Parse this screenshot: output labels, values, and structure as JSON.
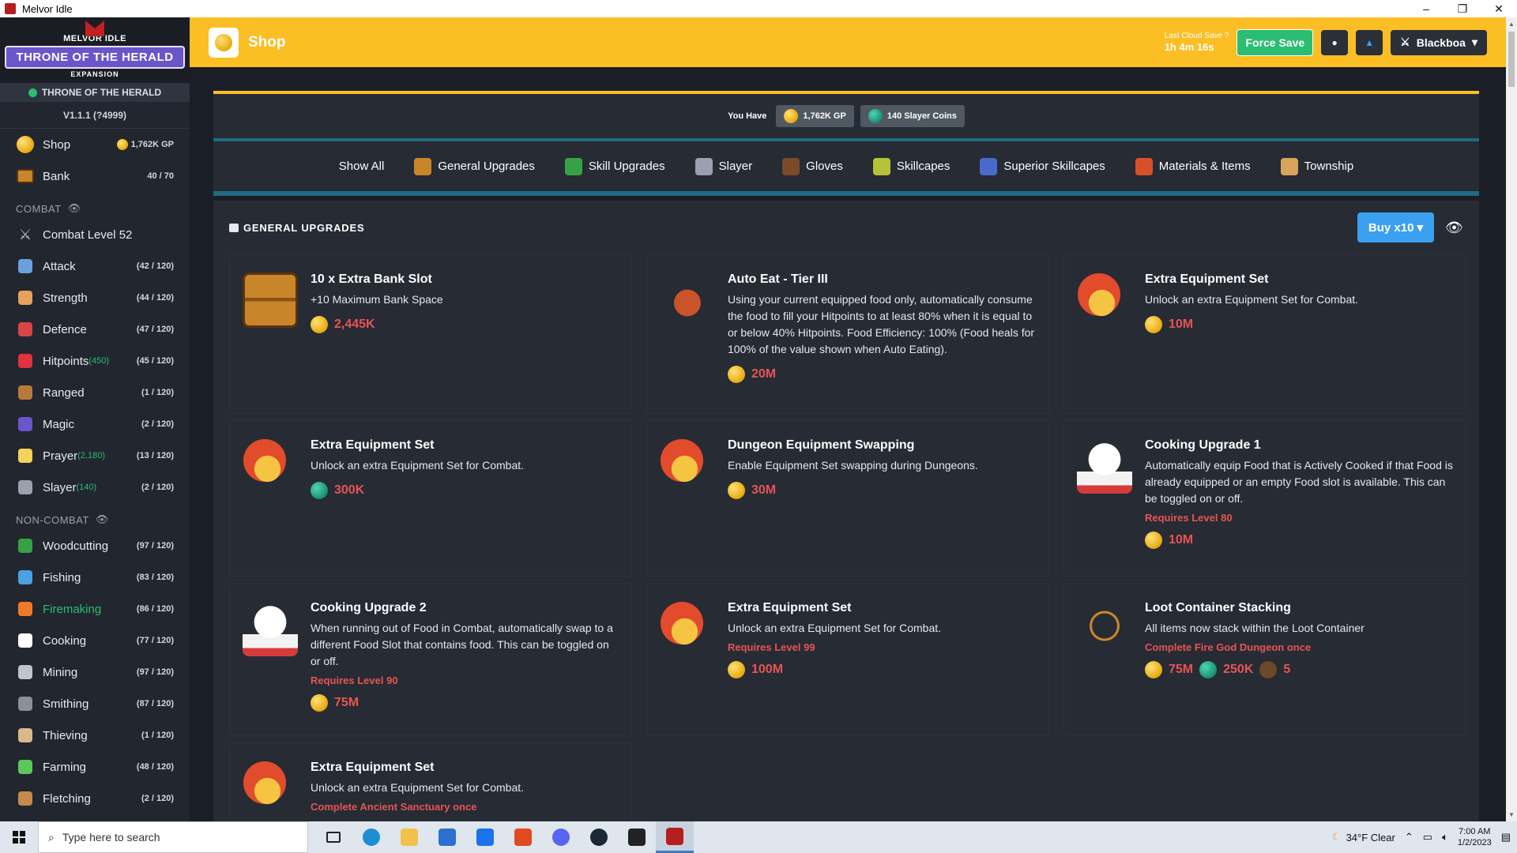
{
  "window": {
    "title": "Melvor Idle",
    "controls": [
      "–",
      "❐",
      "✕"
    ]
  },
  "logo": {
    "top": "MELVOR IDLE",
    "main": "THRONE OF THE HERALD",
    "sub": "EXPANSION"
  },
  "sidebar": {
    "expansion": "THRONE OF THE HERALD",
    "version": "V1.1.1 (?4999)",
    "top_items": [
      {
        "label": "Shop",
        "right": "1,762K GP",
        "icon": "shop-icon"
      },
      {
        "label": "Bank",
        "right": "40 / 70",
        "icon": "bank-icon"
      }
    ],
    "combat_label": "COMBAT",
    "combat_level": "Combat Level 52",
    "combat_items": [
      {
        "label": "Attack",
        "extra": "",
        "right": "(42 / 120)",
        "icon": "sword-icon",
        "color": "#6aa0e0"
      },
      {
        "label": "Strength",
        "extra": "",
        "right": "(44 / 120)",
        "icon": "fist-icon",
        "color": "#e6a15a"
      },
      {
        "label": "Defence",
        "extra": "",
        "right": "(47 / 120)",
        "icon": "shield-icon",
        "color": "#d84545"
      },
      {
        "label": "Hitpoints",
        "extra": "(450)",
        "right": "(45 / 120)",
        "icon": "heart-icon",
        "color": "#e0323f"
      },
      {
        "label": "Ranged",
        "extra": "",
        "right": "(1 / 120)",
        "icon": "bow-icon",
        "color": "#b87a3a"
      },
      {
        "label": "Magic",
        "extra": "",
        "right": "(2 / 120)",
        "icon": "wizard-hat-icon",
        "color": "#6a55c9"
      },
      {
        "label": "Prayer",
        "extra": "(2,180)",
        "right": "(13 / 120)",
        "icon": "prayer-icon",
        "color": "#f5d35a"
      },
      {
        "label": "Slayer",
        "extra": "(140)",
        "right": "(2 / 120)",
        "icon": "slayer-icon",
        "color": "#9aa1ad"
      }
    ],
    "noncombat_label": "NON-COMBAT",
    "noncombat_items": [
      {
        "label": "Woodcutting",
        "right": "(97 / 120)",
        "icon": "tree-icon",
        "color": "#37a245",
        "active": false
      },
      {
        "label": "Fishing",
        "right": "(83 / 120)",
        "icon": "fish-icon",
        "color": "#4aa3e0",
        "active": false
      },
      {
        "label": "Firemaking",
        "right": "(86 / 120)",
        "icon": "fire-icon",
        "color": "#f07a2a",
        "active": true
      },
      {
        "label": "Cooking",
        "right": "(77 / 120)",
        "icon": "chef-hat-icon",
        "color": "#ffffff",
        "active": false
      },
      {
        "label": "Mining",
        "right": "(97 / 120)",
        "icon": "pickaxe-icon",
        "color": "#c0c4cc",
        "active": false
      },
      {
        "label": "Smithing",
        "right": "(87 / 120)",
        "icon": "anvil-icon",
        "color": "#8a8f98",
        "active": false
      },
      {
        "label": "Thieving",
        "right": "(1 / 120)",
        "icon": "thief-icon",
        "color": "#d7b98a",
        "active": false
      },
      {
        "label": "Farming",
        "right": "(48 / 120)",
        "icon": "sprout-icon",
        "color": "#5ac85a",
        "active": false
      },
      {
        "label": "Fletching",
        "right": "(2 / 120)",
        "icon": "arrow-icon",
        "color": "#c68a4a",
        "active": false
      }
    ]
  },
  "header": {
    "title": "Shop",
    "cloud_label": "Last Cloud Save",
    "cloud_time": "1h 4m 16s",
    "force_save": "Force Save",
    "character": "Blackboa"
  },
  "wallet": {
    "label": "You Have",
    "gp": "1,762K GP",
    "slayer": "140 Slayer Coins"
  },
  "tabs": [
    {
      "label": "Show All",
      "color": ""
    },
    {
      "label": "General Upgrades",
      "color": "#c9852a"
    },
    {
      "label": "Skill Upgrades",
      "color": "#37a245"
    },
    {
      "label": "Slayer",
      "color": "#9aa1ad"
    },
    {
      "label": "Gloves",
      "color": "#7a4a2a"
    },
    {
      "label": "Skillcapes",
      "color": "#b5c23a"
    },
    {
      "label": "Superior Skillcapes",
      "color": "#4a6ac9"
    },
    {
      "label": "Materials & Items",
      "color": "#d8502a"
    },
    {
      "label": "Township",
      "color": "#d7a45a"
    }
  ],
  "panel": {
    "title": "GENERAL UPGRADES",
    "buy_button": "Buy x10"
  },
  "cards": [
    {
      "name": "10 x Extra Bank Slot",
      "desc": "+10 Maximum Bank Space",
      "icon": "chest-icon",
      "req": "",
      "costs": [
        {
          "type": "gp",
          "value": "2,445K"
        }
      ]
    },
    {
      "name": "Auto Eat - Tier III",
      "desc": "Using your current equipped food only, automatically consume the food to fill your Hitpoints to at least 80% when it is equal to or below 40% Hitpoints. Food Efficiency: 100% (Food heals for 100% of the value shown when Auto Eating).",
      "icon": "crab-icon",
      "req": "",
      "costs": [
        {
          "type": "gp",
          "value": "20M"
        }
      ]
    },
    {
      "name": "Extra Equipment Set",
      "desc": "Unlock an extra Equipment Set for Combat.",
      "icon": "helmet-plus-icon",
      "req": "",
      "costs": [
        {
          "type": "gp",
          "value": "10M"
        }
      ]
    },
    {
      "name": "Extra Equipment Set",
      "desc": "Unlock an extra Equipment Set for Combat.",
      "icon": "helmet-plus-icon",
      "req": "",
      "costs": [
        {
          "type": "slayer",
          "value": "300K"
        }
      ]
    },
    {
      "name": "Dungeon Equipment Swapping",
      "desc": "Enable Equipment Set swapping during Dungeons.",
      "icon": "helmet-swap-icon",
      "req": "",
      "costs": [
        {
          "type": "gp",
          "value": "30M"
        }
      ]
    },
    {
      "name": "Cooking Upgrade 1",
      "desc": "Automatically equip Food that is Actively Cooked if that Food is already equipped or an empty Food slot is available. This can be toggled on or off.",
      "icon": "chef-hat-icon",
      "req": "Requires  Level 80",
      "costs": [
        {
          "type": "gp",
          "value": "10M"
        }
      ]
    },
    {
      "name": "Cooking Upgrade 2",
      "desc": "When running out of Food in Combat, automatically swap to a different Food Slot that contains food. This can be toggled on or off.",
      "icon": "chef-hat-icon",
      "req": "Requires  Level 90",
      "costs": [
        {
          "type": "gp",
          "value": "75M"
        }
      ]
    },
    {
      "name": "Extra Equipment Set",
      "desc": "Unlock an extra Equipment Set for Combat.",
      "icon": "helmet-plus-icon",
      "req": "Requires  Level 99",
      "costs": [
        {
          "type": "gp",
          "value": "100M"
        }
      ]
    },
    {
      "name": "Loot Container Stacking",
      "desc": "All items now stack within the Loot Container",
      "icon": "necklace-icon",
      "req": "Complete  Fire God Dungeon once",
      "costs": [
        {
          "type": "gp",
          "value": "75M"
        },
        {
          "type": "slayer",
          "value": "250K"
        },
        {
          "type": "item",
          "value": "5"
        }
      ]
    },
    {
      "name": "Extra Equipment Set",
      "desc": "Unlock an extra Equipment Set for Combat.",
      "icon": "helmet-plus-icon",
      "req": "Complete  Ancient Sanctuary once",
      "costs": []
    }
  ],
  "taskbar": {
    "search_placeholder": "Type here to search",
    "weather": "34°F  Clear",
    "time": "7:00 AM",
    "date": "1/2/2023"
  }
}
